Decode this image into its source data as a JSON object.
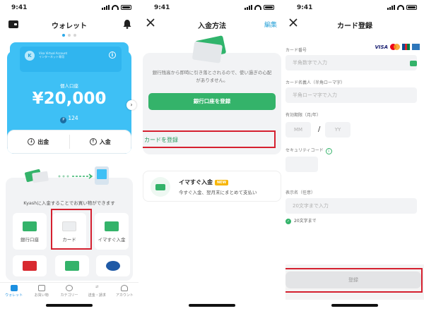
{
  "status": {
    "time": "9:41"
  },
  "screen1": {
    "title": "ウォレット",
    "virtual_card_name": "Visa Virtual Account",
    "virtual_card_sub": "インターネット専用",
    "card_logo": "K",
    "balance_label": "個人口座",
    "balance_amount": "¥20,000",
    "points": "124",
    "withdraw_label": "出金",
    "deposit_label": "入金",
    "kyashi_text": "Kyashに入金することでお買い物ができます",
    "tiles": [
      {
        "label": "銀行口座",
        "color": "#34b36a"
      },
      {
        "label": "カード",
        "color": "#e8eaed"
      },
      {
        "label": "イマすぐ入金",
        "color": "#34b36a"
      },
      {
        "label": "",
        "color": "#d8292f"
      },
      {
        "label": "",
        "color": "#34b36a"
      },
      {
        "label": "",
        "color": "#1f5aa6"
      }
    ],
    "tabs": [
      "ウォレット",
      "お買い物",
      "カテゴリー",
      "送金・請求",
      "アカウント"
    ]
  },
  "screen2": {
    "title": "入金方法",
    "edit_label": "編集",
    "desc": "銀行残高から即時に引き落とされるので、使い過ぎの心配がありません。",
    "bank_button": "銀行口座を登録",
    "card_register": "カードを登録",
    "imasugu_title": "イマすぐ入金",
    "new_badge": "NEW",
    "imasugu_sub": "今すぐ入金、翌月末にまとめて支払い"
  },
  "screen3": {
    "title": "カード登録",
    "card_number_label": "カード番号",
    "card_number_placeholder": "半角数字で入力",
    "visa_label": "VISA",
    "holder_label": "カード名義人（半角ローマ字）",
    "holder_placeholder": "半角ローマ字で入力",
    "expiry_label": "有効期限（月/年）",
    "mm_placeholder": "MM",
    "slash": "/",
    "yy_placeholder": "YY",
    "security_label": "セキュリティコード",
    "display_name_label": "表示名（任意）",
    "display_name_placeholder": "20文字まで入力",
    "char_limit_note": "20文字まで",
    "register_button": "登録"
  },
  "colors": {
    "accent_blue": "#3ec0f5",
    "accent_green": "#34b36a",
    "highlight_red": "#d5202f"
  }
}
